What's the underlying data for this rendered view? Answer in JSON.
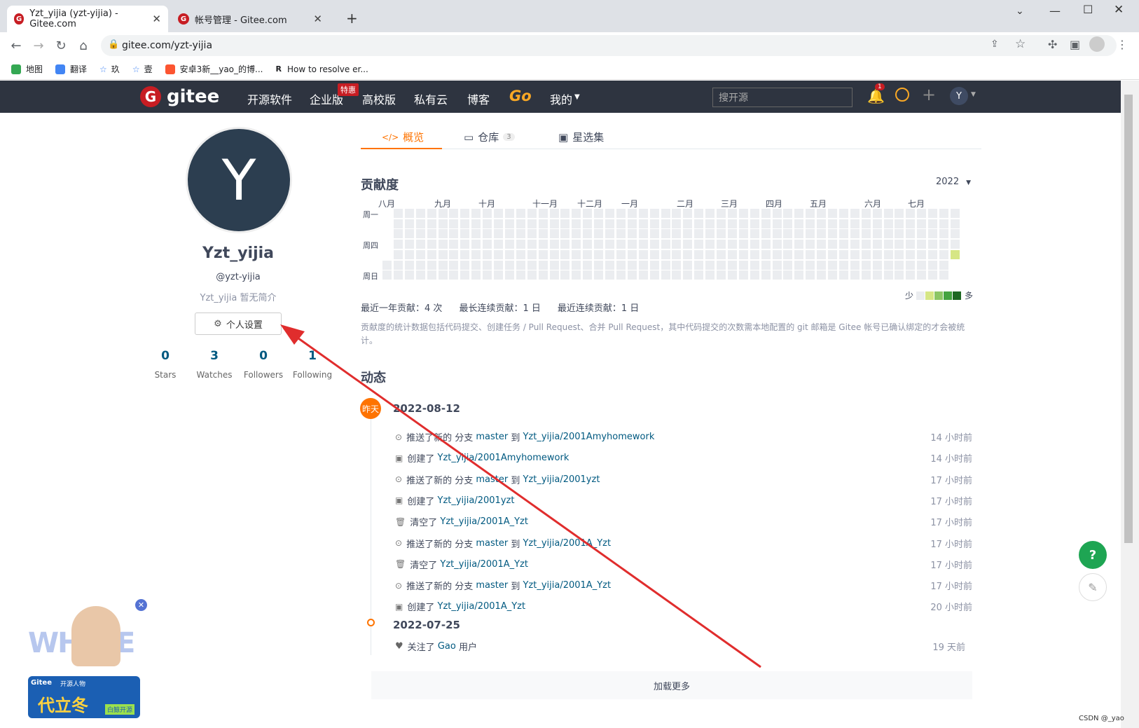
{
  "browser": {
    "tabs": [
      {
        "title": "Yzt_yijia (yzt-yijia) - Gitee.com"
      },
      {
        "title": "帐号管理 - Gitee.com"
      }
    ],
    "url": "gitee.com/yzt-yijia",
    "bookmarks": [
      "地图",
      "翻译",
      "玖",
      "壹",
      "安卓3新__yao_的博...",
      "How to resolve er..."
    ]
  },
  "nav": {
    "brand": "gitee",
    "items": [
      "开源软件",
      "企业版",
      "高校版",
      "私有云",
      "博客",
      "Go",
      "我的"
    ],
    "hot_badge": "特惠",
    "search_placeholder": "搜开源",
    "notif_count": "1",
    "avatar_letter": "Y"
  },
  "profile": {
    "avatar_letter": "Y",
    "name": "Yzt_yijia",
    "handle": "@yzt-yijia",
    "bio": "Yzt_yijia 暂无简介",
    "settings_label": "个人设置",
    "stats": [
      {
        "n": "0",
        "l": "Stars"
      },
      {
        "n": "3",
        "l": "Watches"
      },
      {
        "n": "0",
        "l": "Followers"
      },
      {
        "n": "1",
        "l": "Following"
      }
    ]
  },
  "tabs": [
    {
      "label": "概览"
    },
    {
      "label": "仓库",
      "count": "3"
    },
    {
      "label": "星选集"
    }
  ],
  "contrib": {
    "title": "贡献度",
    "year": "2022",
    "months": [
      "八月",
      "九月",
      "十月",
      "十一月",
      "十二月",
      "一月",
      "二月",
      "三月",
      "四月",
      "五月",
      "六月",
      "七月"
    ],
    "weekdays": [
      "周一",
      "周四",
      "周日"
    ],
    "legend_less": "少",
    "legend_more": "多",
    "summary": [
      {
        "label": "最近一年贡献",
        "value": "4 次"
      },
      {
        "label": "最长连续贡献",
        "value": "1 日"
      },
      {
        "label": "最近连续贡献",
        "value": "1 日"
      }
    ],
    "note": "贡献度的统计数据包括代码提交、创建任务 / Pull Request、合并 Pull Request，其中代码提交的次数需本地配置的 git 邮箱是 Gitee 帐号已确认绑定的才会被统计。",
    "colors": [
      "#ebedf0",
      "#d6e685",
      "#8cc665",
      "#44a340",
      "#1e6823"
    ]
  },
  "feed": {
    "title": "动态",
    "day_badge": "昨天",
    "groups": [
      {
        "date": "2022-08-12",
        "events": [
          {
            "icon": "push-icon",
            "action": "推送了新的 分支",
            "branch": "master",
            "to": "到",
            "repo": "Yzt_yijia/2001Amyhomework",
            "time": "14 小时前"
          },
          {
            "icon": "repo-icon",
            "action": "创建了",
            "branch": "",
            "to": "",
            "repo": "Yzt_yijia/2001Amyhomework",
            "time": "14 小时前"
          },
          {
            "icon": "push-icon",
            "action": "推送了新的 分支",
            "branch": "master",
            "to": "到",
            "repo": "Yzt_yijia/2001yzt",
            "time": "17 小时前"
          },
          {
            "icon": "repo-icon",
            "action": "创建了",
            "branch": "",
            "to": "",
            "repo": "Yzt_yijia/2001yzt",
            "time": "17 小时前"
          },
          {
            "icon": "trash-icon",
            "action": "清空了",
            "branch": "",
            "to": "",
            "repo": "Yzt_yijia/2001A_Yzt",
            "time": "17 小时前"
          },
          {
            "icon": "push-icon",
            "action": "推送了新的 分支",
            "branch": "master",
            "to": "到",
            "repo": "Yzt_yijia/2001A_Yzt",
            "time": "17 小时前"
          },
          {
            "icon": "trash-icon",
            "action": "清空了",
            "branch": "",
            "to": "",
            "repo": "Yzt_yijia/2001A_Yzt",
            "time": "17 小时前"
          },
          {
            "icon": "push-icon",
            "action": "推送了新的 分支",
            "branch": "master",
            "to": "到",
            "repo": "Yzt_yijia/2001A_Yzt",
            "time": "17 小时前"
          },
          {
            "icon": "repo-icon",
            "action": "创建了",
            "branch": "",
            "to": "",
            "repo": "Yzt_yijia/2001A_Yzt",
            "time": "20 小时前"
          }
        ]
      },
      {
        "date": "2022-07-25",
        "events": [
          {
            "icon": "heart-icon",
            "action": "关注了",
            "branch": "",
            "to": "",
            "repo": "Gao",
            "suffix": "用户",
            "time": "19 天前"
          }
        ]
      }
    ],
    "load_more": "加载更多"
  },
  "ad": {
    "brand": "Gitee",
    "slogan": "开源人物",
    "name": "代立冬",
    "tag": "白鲸开源",
    "bg_text": "WHALE"
  },
  "watermark": "CSDN @_yao"
}
